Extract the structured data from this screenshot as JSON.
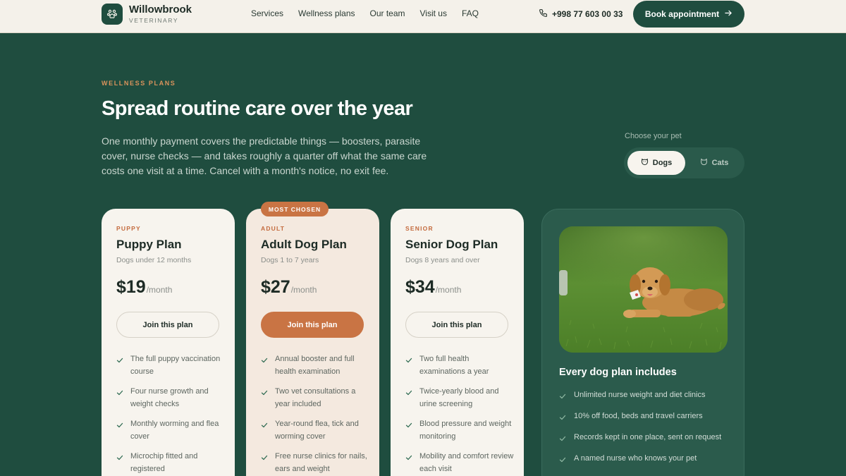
{
  "brand": {
    "name": "Willowbrook",
    "sub": "VETERINARY"
  },
  "nav": [
    "Services",
    "Wellness plans",
    "Our team",
    "Visit us",
    "FAQ"
  ],
  "header": {
    "phone": "+998 77 603 00 33",
    "book_label": "Book appointment"
  },
  "hero": {
    "eyebrow": "WELLNESS PLANS",
    "title": "Spread routine care over the year",
    "lead": "One monthly payment covers the predictable things — boosters, parasite cover, nurse checks — and takes roughly a quarter off what the same care costs one visit at a time. Cancel with a month's notice, no exit fee."
  },
  "pet_selector": {
    "label": "Choose your pet",
    "options": [
      "Dogs",
      "Cats"
    ],
    "selected": "Dogs"
  },
  "plans": [
    {
      "tier": "PUPPY",
      "name": "Puppy Plan",
      "desc": "Dogs under 12 months",
      "price": "$19",
      "per": "/month",
      "cta": "Join this plan",
      "features": [
        "The full puppy vaccination course",
        "Four nurse growth and weight checks",
        "Monthly worming and flea cover",
        "Microchip fitted and registered"
      ]
    },
    {
      "tier": "ADULT",
      "name": "Adult Dog Plan",
      "desc": "Dogs 1 to 7 years",
      "price": "$27",
      "per": "/month",
      "cta": "Join this plan",
      "badge": "MOST CHOSEN",
      "features": [
        "Annual booster and full health examination",
        "Two vet consultations a year included",
        "Year-round flea, tick and worming cover",
        "Free nurse clinics for nails, ears and weight"
      ]
    },
    {
      "tier": "SENIOR",
      "name": "Senior Dog Plan",
      "desc": "Dogs 8 years and over",
      "price": "$34",
      "per": "/month",
      "cta": "Join this plan",
      "features": [
        "Two full health examinations a year",
        "Twice-yearly blood and urine screening",
        "Blood pressure and weight monitoring",
        "Mobility and comfort review each visit"
      ]
    }
  ],
  "includes": {
    "title": "Every dog plan includes",
    "items": [
      "Unlimited nurse weight and diet clinics",
      "10% off food, beds and travel carriers",
      "Records kept in one place, sent on request",
      "A named nurse who knows your pet"
    ]
  },
  "colors": {
    "brand_green": "#1f4d3f",
    "accent_orange": "#c97444",
    "cream": "#f7f4ee"
  }
}
